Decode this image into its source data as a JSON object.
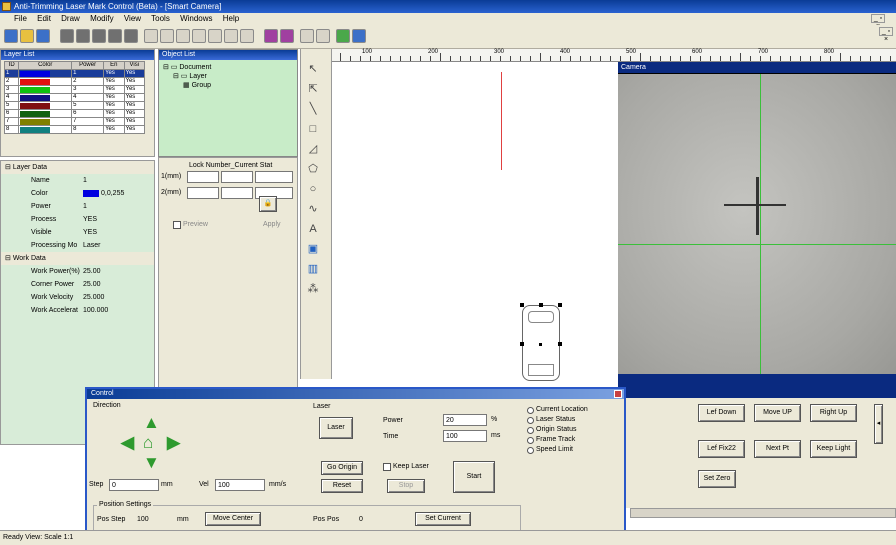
{
  "window": {
    "title": "Anti-Trimming Laser Mark Control (Beta) - [Smart Camera]"
  },
  "menu": [
    "File",
    "Edit",
    "Draw",
    "Modify",
    "View",
    "Tools",
    "Windows",
    "Help"
  ],
  "layer_panel": {
    "title": "Layer List",
    "columns": [
      "ID",
      "Color",
      "Power",
      "En",
      "Visi"
    ],
    "rows": [
      {
        "id": "1",
        "color": "#0000e0",
        "power": "1",
        "en": "Yes",
        "vis": "Yes"
      },
      {
        "id": "2",
        "color": "#e01010",
        "power": "2",
        "en": "Yes",
        "vis": "Yes"
      },
      {
        "id": "3",
        "color": "#10c010",
        "power": "3",
        "en": "Yes",
        "vis": "Yes"
      },
      {
        "id": "4",
        "color": "#101080",
        "power": "4",
        "en": "Yes",
        "vis": "Yes"
      },
      {
        "id": "5",
        "color": "#801010",
        "power": "5",
        "en": "Yes",
        "vis": "Yes"
      },
      {
        "id": "6",
        "color": "#106010",
        "power": "6",
        "en": "Yes",
        "vis": "Yes"
      },
      {
        "id": "7",
        "color": "#808000",
        "power": "7",
        "en": "Yes",
        "vis": "Yes"
      },
      {
        "id": "8",
        "color": "#108080",
        "power": "8",
        "en": "Yes",
        "vis": "Yes"
      }
    ]
  },
  "properties": {
    "layer_section": "Layer Data",
    "items": [
      {
        "label": "Name",
        "value": "1"
      },
      {
        "label": "Color",
        "value": "0,0,255"
      },
      {
        "label": "Power",
        "value": "1"
      },
      {
        "label": "Process",
        "value": "YES"
      },
      {
        "label": "Visible",
        "value": "YES"
      },
      {
        "label": "Processing Mo",
        "value": "Laser"
      }
    ],
    "work_section": "Work Data",
    "work_items": [
      {
        "label": "Work Power(%)",
        "value": "25.00"
      },
      {
        "label": "Corner Power",
        "value": "25.00"
      },
      {
        "label": "Work Velocity",
        "value": "25.000"
      },
      {
        "label": "Work Accelerat",
        "value": "100.000"
      }
    ]
  },
  "tree": {
    "title": "Object List",
    "nodes": [
      "Document",
      "Layer",
      "Group"
    ]
  },
  "tablet": {
    "header": "Lock Number_Current  Stat",
    "rows": [
      "1(mm)",
      "2(mm)"
    ],
    "preview_label": "Preview",
    "apply_label": "Apply"
  },
  "ruler_labels": [
    "100",
    "200",
    "300",
    "400",
    "500",
    "600",
    "700",
    "800"
  ],
  "camera": {
    "title": "Camera",
    "buttons": {
      "right_down": "Lef Down",
      "move_up": "Move UP",
      "right_up": "Right Up",
      "left_fixed": "Lef Fix22",
      "next": "Next Pt",
      "keep_light": "Keep Light",
      "set_zero": "Set Zero"
    }
  },
  "control": {
    "title": "Control",
    "direction_label": "Direction",
    "move_label": "Step",
    "step_value": "0",
    "step_unit": "mm",
    "velocity_label": "Vel",
    "velocity_value": "100",
    "velocity_unit": "mm/s",
    "laser_group": "Laser",
    "laser_btn": "Laser",
    "power_label": "Power",
    "power_value": "20",
    "power_unit": "%",
    "time_label": "Time",
    "time_value": "100",
    "time_unit": "ms",
    "origin_btn": "Go Origin",
    "reset_btn": "Reset",
    "keep_label": "Keep Laser",
    "stop_label": "Stop",
    "start_btn": "Start",
    "lower_group": "Position Settings",
    "pos_label": "Pos Step",
    "pos_value": "100",
    "pos_unit": "mm",
    "pos_btn": "Move Center",
    "sec_label": "Pos Pos",
    "sec_value": "0",
    "origin2_btn": "Set Current",
    "options": [
      "Current Location",
      "Laser Status",
      "Origin Status",
      "Frame Track",
      "Speed Limit"
    ]
  },
  "status": {
    "text": "Ready   View: Scale 1:1"
  }
}
